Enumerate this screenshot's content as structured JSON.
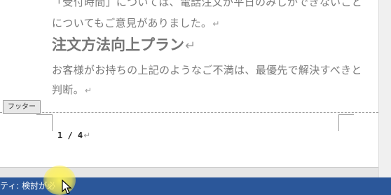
{
  "document": {
    "lines": [
      "「受付時間」については、電話注文が平日のみしかできないこと",
      "についてもご意見がありました。",
      "お客様がお持ちの上記のようなご不満は、最優先で解決すべきと",
      "判断。"
    ],
    "heading": "注文方法向上プラン",
    "paragraph_mark": "↵"
  },
  "footer": {
    "tab_label": "フッター",
    "page_number": "1 / 4"
  },
  "status_bar": {
    "accessibility_text": "ティ: 検討が必"
  },
  "colors": {
    "status_bar": "#2b579a",
    "highlight": "#fff05a"
  }
}
